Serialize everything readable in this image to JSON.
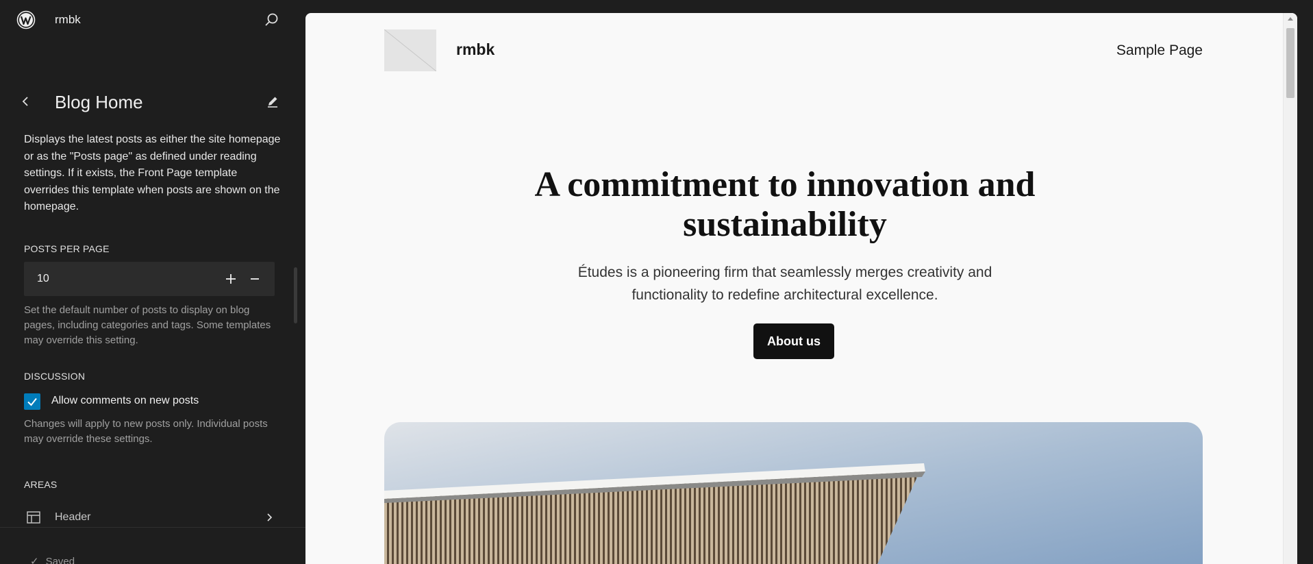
{
  "header": {
    "site_name": "rmbk",
    "logo_icon": "wordpress-logo-icon",
    "search_icon": "search-icon"
  },
  "panel": {
    "title": "Blog Home",
    "back_icon": "chevron-left-icon",
    "edit_icon": "pencil-icon",
    "description": "Displays the latest posts as either the site homepage or as the \"Posts page\" as defined under reading settings. If it exists, the Front Page template overrides this template when posts are shown on the homepage."
  },
  "posts_per_page": {
    "label": "POSTS PER PAGE",
    "value": "10",
    "help": "Set the default number of posts to display on blog pages, including categories and tags. Some templates may override this setting."
  },
  "discussion": {
    "label": "DISCUSSION",
    "checkbox_label": "Allow comments on new posts",
    "checked": true,
    "help": "Changes will apply to new posts only. Individual posts may override these settings."
  },
  "areas": {
    "label": "AREAS",
    "items": [
      {
        "label": "Header",
        "icon": "template-part-header-icon"
      }
    ]
  },
  "footer": {
    "saved_label": "Saved"
  },
  "colors": {
    "accent": "#007cba",
    "sidebar_bg": "#1e1e1e",
    "preview_bg": "#f9f9f9"
  },
  "preview": {
    "site_title": "rmbk",
    "nav_link": "Sample Page",
    "heading": "A commitment to innovation and sustainability",
    "subheading": "Études is a pioneering firm that seamlessly merges creativity and functionality to redefine architectural excellence.",
    "cta_label": "About us"
  }
}
